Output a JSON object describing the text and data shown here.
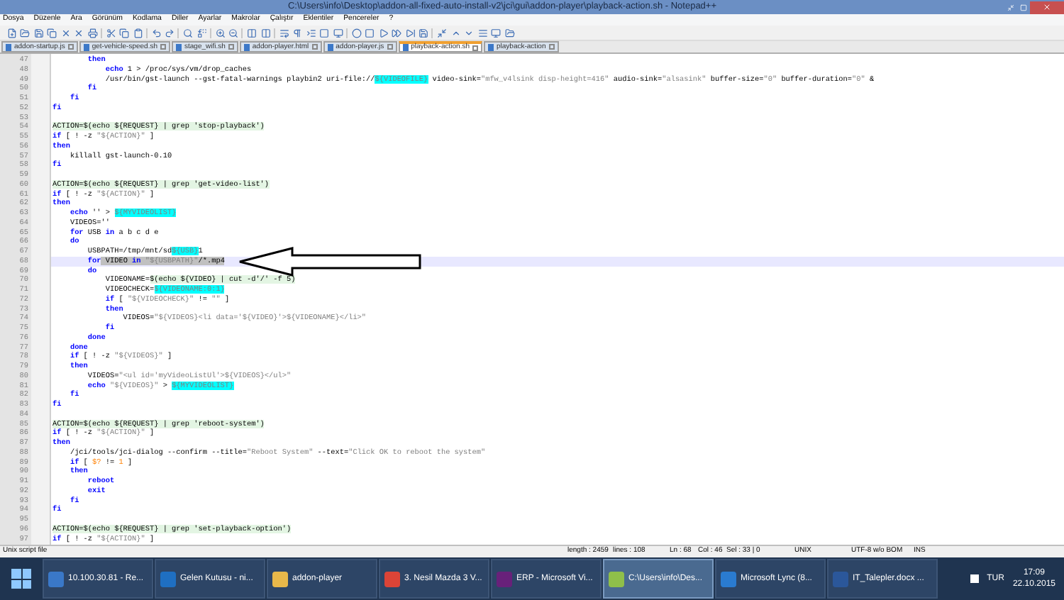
{
  "window": {
    "title": "C:\\Users\\info\\Desktop\\addon-all-fixed-auto-install-v2\\jci\\gui\\addon-player\\playback-action.sh - Notepad++"
  },
  "menu": [
    "Dosya",
    "Düzenle",
    "Ara",
    "Görünüm",
    "Kodlama",
    "Diller",
    "Ayarlar",
    "Makrolar",
    "Çalıştır",
    "Eklentiler",
    "Pencereler",
    "?"
  ],
  "tabs": [
    {
      "label": "addon-startup.js",
      "selected": false
    },
    {
      "label": "get-vehicle-speed.sh",
      "selected": false
    },
    {
      "label": "stage_wifi.sh",
      "selected": false
    },
    {
      "label": "addon-player.html",
      "selected": false
    },
    {
      "label": "addon-player.js",
      "selected": false
    },
    {
      "label": "playback-action.sh",
      "selected": true
    },
    {
      "label": "playback-action",
      "selected": false
    }
  ],
  "editor": {
    "lines": [
      {
        "number": "47",
        "selected": false,
        "segments": [
          {
            "kind": "kw",
            "text": "        then"
          }
        ]
      },
      {
        "number": "48",
        "selected": false,
        "segments": [
          {
            "kind": "kw",
            "text": "            echo"
          },
          {
            "kind": "text",
            "text": " 1 > /proc/sys/vm/drop_caches"
          }
        ]
      },
      {
        "number": "49",
        "selected": false,
        "segments": [
          {
            "kind": "text",
            "text": "            /usr/bin/gst-launch --gst-fatal-warnings playbin2 uri-file://"
          },
          {
            "kind": "var",
            "text": "${VIDEOFILE}"
          },
          {
            "kind": "text",
            "text": " video-sink="
          },
          {
            "kind": "str",
            "text": "\"mfw_v4lsink disp-height=416\""
          },
          {
            "kind": "text",
            "text": " audio-sink="
          },
          {
            "kind": "str",
            "text": "\"alsasink\""
          },
          {
            "kind": "text",
            "text": " buffer-size="
          },
          {
            "kind": "str",
            "text": "\"0\""
          },
          {
            "kind": "text",
            "text": " buffer-duration="
          },
          {
            "kind": "str",
            "text": "\"0\""
          },
          {
            "kind": "text",
            "text": " &"
          }
        ]
      },
      {
        "number": "50",
        "selected": false,
        "segments": [
          {
            "kind": "kw",
            "text": "        fi"
          }
        ]
      },
      {
        "number": "51",
        "selected": false,
        "segments": [
          {
            "kind": "kw",
            "text": "    fi"
          }
        ]
      },
      {
        "number": "52",
        "selected": false,
        "segments": [
          {
            "kind": "kw",
            "text": "fi"
          }
        ]
      },
      {
        "number": "53",
        "selected": false
      },
      {
        "number": "54",
        "selected": false,
        "segments": [
          {
            "kind": "marked",
            "text": "ACTION=$(echo ${REQUEST} | grep 'stop-playback')"
          }
        ]
      },
      {
        "number": "55",
        "selected": false,
        "segments": [
          {
            "kind": "kw",
            "text": "if"
          },
          {
            "kind": "text",
            "text": " [ ! -z "
          },
          {
            "kind": "str",
            "text": "\"${ACTION}\""
          },
          {
            "kind": "text",
            "text": " ]"
          }
        ]
      },
      {
        "number": "56",
        "selected": false,
        "segments": [
          {
            "kind": "kw",
            "text": "then"
          }
        ]
      },
      {
        "number": "57",
        "selected": false,
        "segments": [
          {
            "kind": "text",
            "text": "    killall gst-launch-0.10"
          }
        ]
      },
      {
        "number": "58",
        "selected": false,
        "segments": [
          {
            "kind": "kw",
            "text": "fi"
          }
        ]
      },
      {
        "number": "59",
        "selected": false
      },
      {
        "number": "60",
        "selected": false,
        "segments": [
          {
            "kind": "marked",
            "text": "ACTION=$(echo ${REQUEST} | grep 'get-video-list')"
          }
        ]
      },
      {
        "number": "61",
        "selected": false,
        "segments": [
          {
            "kind": "kw",
            "text": "if"
          },
          {
            "kind": "text",
            "text": " [ ! -z "
          },
          {
            "kind": "str",
            "text": "\"${ACTION}\""
          },
          {
            "kind": "text",
            "text": " ]"
          }
        ]
      },
      {
        "number": "62",
        "selected": false,
        "segments": [
          {
            "kind": "kw",
            "text": "then"
          }
        ]
      },
      {
        "number": "63",
        "selected": false,
        "segments": [
          {
            "kind": "kw",
            "text": "    echo"
          },
          {
            "kind": "text",
            "text": " '' > "
          },
          {
            "kind": "var",
            "text": "${MYVIDEOLIST}"
          }
        ]
      },
      {
        "number": "64",
        "selected": false,
        "segments": [
          {
            "kind": "text",
            "text": "    VIDEOS=''"
          }
        ]
      },
      {
        "number": "65",
        "selected": false,
        "segments": [
          {
            "kind": "kw",
            "text": "    for"
          },
          {
            "kind": "text",
            "text": " USB "
          },
          {
            "kind": "kw",
            "text": "in"
          },
          {
            "kind": "text",
            "text": " a b c d e"
          }
        ]
      },
      {
        "number": "66",
        "selected": false,
        "segments": [
          {
            "kind": "kw",
            "text": "    do"
          }
        ]
      },
      {
        "number": "67",
        "selected": false,
        "segments": [
          {
            "kind": "text",
            "text": "        USBPATH=/tmp/mnt/sd"
          },
          {
            "kind": "var",
            "text": "${USB}"
          },
          {
            "kind": "text",
            "text": "1"
          }
        ]
      },
      {
        "number": "68",
        "selected": true,
        "segments": [
          {
            "kind": "kw",
            "text": "        for"
          },
          {
            "kind": "text",
            "text": " VIDEO "
          },
          {
            "kind": "kw",
            "text": "in"
          },
          {
            "kind": "str",
            "text": " \"${USBPATH}\""
          },
          {
            "kind": "text",
            "text": "/*.mp4"
          }
        ]
      },
      {
        "number": "69",
        "selected": false,
        "segments": [
          {
            "kind": "kw",
            "text": "        do"
          }
        ]
      },
      {
        "number": "70",
        "selected": false,
        "segments": [
          {
            "kind": "text",
            "text": "            VIDEONAME="
          },
          {
            "kind": "marked",
            "text": "$(echo ${VIDEO} | cut -d'/' -f 5)"
          }
        ]
      },
      {
        "number": "71",
        "selected": false,
        "segments": [
          {
            "kind": "text",
            "text": "            VIDEOCHECK="
          },
          {
            "kind": "var",
            "text": "${VIDEONAME:0:1}"
          }
        ]
      },
      {
        "number": "72",
        "selected": false,
        "segments": [
          {
            "kind": "kw",
            "text": "            if"
          },
          {
            "kind": "text",
            "text": " [ "
          },
          {
            "kind": "str",
            "text": "\"${VIDEOCHECK}\""
          },
          {
            "kind": "text",
            "text": " != "
          },
          {
            "kind": "str",
            "text": "\"\""
          },
          {
            "kind": "text",
            "text": " ]"
          }
        ]
      },
      {
        "number": "73",
        "selected": false,
        "segments": [
          {
            "kind": "kw",
            "text": "            then"
          }
        ]
      },
      {
        "number": "74",
        "selected": false,
        "segments": [
          {
            "kind": "text",
            "text": "                VIDEOS="
          },
          {
            "kind": "str",
            "text": "\"${VIDEOS}<li data='${VIDEO}'>${VIDEONAME}</li>\""
          }
        ]
      },
      {
        "number": "75",
        "selected": false,
        "segments": [
          {
            "kind": "kw",
            "text": "            fi"
          }
        ]
      },
      {
        "number": "76",
        "selected": false,
        "segments": [
          {
            "kind": "kw",
            "text": "        done"
          }
        ]
      },
      {
        "number": "77",
        "selected": false,
        "segments": [
          {
            "kind": "kw",
            "text": "    done"
          }
        ]
      },
      {
        "number": "78",
        "selected": false,
        "segments": [
          {
            "kind": "kw",
            "text": "    if"
          },
          {
            "kind": "text",
            "text": " [ ! -z "
          },
          {
            "kind": "str",
            "text": "\"${VIDEOS}\""
          },
          {
            "kind": "text",
            "text": " ]"
          }
        ]
      },
      {
        "number": "79",
        "selected": false,
        "segments": [
          {
            "kind": "kw",
            "text": "    then"
          }
        ]
      },
      {
        "number": "80",
        "selected": false,
        "segments": [
          {
            "kind": "text",
            "text": "        VIDEOS="
          },
          {
            "kind": "str",
            "text": "\"<ul id='myVideoListUl'>${VIDEOS}</ul>\""
          }
        ]
      },
      {
        "number": "81",
        "selected": false,
        "segments": [
          {
            "kind": "kw",
            "text": "        echo"
          },
          {
            "kind": "str",
            "text": " \"${VIDEOS}\""
          },
          {
            "kind": "text",
            "text": " > "
          },
          {
            "kind": "var",
            "text": "${MYVIDEOLIST}"
          }
        ]
      },
      {
        "number": "82",
        "selected": false,
        "segments": [
          {
            "kind": "kw",
            "text": "    fi"
          }
        ]
      },
      {
        "number": "83",
        "selected": false,
        "segments": [
          {
            "kind": "kw",
            "text": "fi"
          }
        ]
      },
      {
        "number": "84",
        "selected": false
      },
      {
        "number": "85",
        "selected": false,
        "segments": [
          {
            "kind": "marked",
            "text": "ACTION=$(echo ${REQUEST} | grep 'reboot-system')"
          }
        ]
      },
      {
        "number": "86",
        "selected": false,
        "segments": [
          {
            "kind": "kw",
            "text": "if"
          },
          {
            "kind": "text",
            "text": " [ ! -z "
          },
          {
            "kind": "str",
            "text": "\"${ACTION}\""
          },
          {
            "kind": "text",
            "text": " ]"
          }
        ]
      },
      {
        "number": "87",
        "selected": false,
        "segments": [
          {
            "kind": "kw",
            "text": "then"
          }
        ]
      },
      {
        "number": "88",
        "selected": false,
        "segments": [
          {
            "kind": "text",
            "text": "    /jci/tools/jci-dialog --confirm --title="
          },
          {
            "kind": "str",
            "text": "\"Reboot System\""
          },
          {
            "kind": "text",
            "text": " --text="
          },
          {
            "kind": "str",
            "text": "\"Click OK to reboot the system\""
          }
        ]
      },
      {
        "number": "89",
        "selected": false,
        "segments": [
          {
            "kind": "kw",
            "text": "    if"
          },
          {
            "kind": "text",
            "text": " [ "
          },
          {
            "kind": "num",
            "text": "$?"
          },
          {
            "kind": "text",
            "text": " != "
          },
          {
            "kind": "num",
            "text": "1"
          },
          {
            "kind": "text",
            "text": " ]"
          }
        ]
      },
      {
        "number": "90",
        "selected": false,
        "segments": [
          {
            "kind": "kw",
            "text": "    then"
          }
        ]
      },
      {
        "number": "91",
        "selected": false,
        "segments": [
          {
            "kind": "kw",
            "text": "        reboot"
          }
        ]
      },
      {
        "number": "92",
        "selected": false,
        "segments": [
          {
            "kind": "kw",
            "text": "        exit"
          }
        ]
      },
      {
        "number": "93",
        "selected": false,
        "segments": [
          {
            "kind": "kw",
            "text": "    fi"
          }
        ]
      },
      {
        "number": "94",
        "selected": false,
        "segments": [
          {
            "kind": "kw",
            "text": "fi"
          }
        ]
      },
      {
        "number": "95",
        "selected": false
      },
      {
        "number": "96",
        "selected": false,
        "segments": [
          {
            "kind": "marked",
            "text": "ACTION=$(echo ${REQUEST} | grep 'set-playback-option')"
          }
        ]
      },
      {
        "number": "97",
        "selected": false,
        "segments": [
          {
            "kind": "kw",
            "text": "if"
          },
          {
            "kind": "text",
            "text": " [ ! -z "
          },
          {
            "kind": "str",
            "text": "\"${ACTION}\""
          },
          {
            "kind": "text",
            "text": " ]"
          }
        ]
      }
    ]
  },
  "status_bar": {
    "file_type": "Unix script file",
    "length": "length : 2459",
    "lines": "lines : 108",
    "ln": "Ln : 68",
    "col": "Col : 46",
    "sel": "Sel : 33 | 0",
    "eol": "UNIX",
    "encoding": "UTF-8 w/o BOM",
    "mode": "INS"
  },
  "taskbar": {
    "items": [
      {
        "label": "10.100.30.81 - Re...",
        "selected": false,
        "color": "#3a78c8"
      },
      {
        "label": "Gelen Kutusu - ni...",
        "selected": false,
        "color": "#1f6fc2"
      },
      {
        "label": "addon-player",
        "selected": false,
        "color": "#e8b84a"
      },
      {
        "label": "3. Nesil Mazda 3 V...",
        "selected": false,
        "color": "#db4437"
      },
      {
        "label": "ERP - Microsoft Vi...",
        "selected": false,
        "color": "#68217a"
      },
      {
        "label": "C:\\Users\\info\\Des...",
        "selected": true,
        "color": "#8fbf4a"
      },
      {
        "label": "Microsoft Lync (8...",
        "selected": false,
        "color": "#2a7bd0"
      },
      {
        "label": "IT_Talepler.docx ...",
        "selected": false,
        "color": "#2b579a"
      }
    ],
    "language": "TUR",
    "time": "17:09",
    "date": "22.10.2015"
  }
}
